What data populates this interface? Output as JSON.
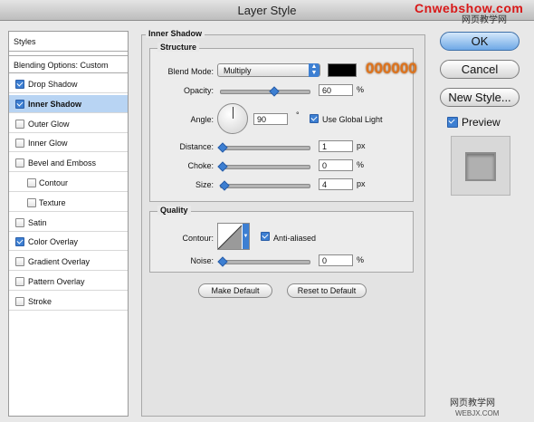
{
  "window": {
    "title": "Layer Style",
    "watermark_top": "Cnwebshow.com",
    "watermark_sub": "网页教学网",
    "watermark_bottom": "网页教学网",
    "watermark_bottom_url": "WEBJX.COM"
  },
  "sidebar": {
    "styles_header": "Styles",
    "blending_options": "Blending Options: Custom",
    "items": [
      {
        "label": "Drop Shadow",
        "checked": true,
        "selected": false,
        "indent": false
      },
      {
        "label": "Inner Shadow",
        "checked": true,
        "selected": true,
        "indent": false
      },
      {
        "label": "Outer Glow",
        "checked": false,
        "selected": false,
        "indent": false
      },
      {
        "label": "Inner Glow",
        "checked": false,
        "selected": false,
        "indent": false
      },
      {
        "label": "Bevel and Emboss",
        "checked": false,
        "selected": false,
        "indent": false
      },
      {
        "label": "Contour",
        "checked": false,
        "selected": false,
        "indent": true
      },
      {
        "label": "Texture",
        "checked": false,
        "selected": false,
        "indent": true
      },
      {
        "label": "Satin",
        "checked": false,
        "selected": false,
        "indent": false
      },
      {
        "label": "Color Overlay",
        "checked": true,
        "selected": false,
        "indent": false
      },
      {
        "label": "Gradient Overlay",
        "checked": false,
        "selected": false,
        "indent": false
      },
      {
        "label": "Pattern Overlay",
        "checked": false,
        "selected": false,
        "indent": false
      },
      {
        "label": "Stroke",
        "checked": false,
        "selected": false,
        "indent": false
      }
    ]
  },
  "panel": {
    "title": "Inner Shadow",
    "structure": {
      "title": "Structure",
      "blend_mode_label": "Blend Mode:",
      "blend_mode_value": "Multiply",
      "color_swatch": "#000000",
      "color_annotation": "000000",
      "opacity_label": "Opacity:",
      "opacity_value": "60",
      "opacity_unit": "%",
      "opacity_level": 0.6,
      "angle_label": "Angle:",
      "angle_value": "90",
      "angle_unit": "°",
      "use_global_light_label": "Use Global Light",
      "use_global_light_checked": true,
      "distance_label": "Distance:",
      "distance_value": "1",
      "distance_unit": "px",
      "choke_label": "Choke:",
      "choke_value": "0",
      "choke_unit": "%",
      "size_label": "Size:",
      "size_value": "4",
      "size_unit": "px"
    },
    "quality": {
      "title": "Quality",
      "contour_label": "Contour:",
      "anti_aliased_label": "Anti-aliased",
      "anti_aliased_checked": true,
      "noise_label": "Noise:",
      "noise_value": "0",
      "noise_unit": "%"
    },
    "make_default": "Make Default",
    "reset_to_default": "Reset to Default"
  },
  "actions": {
    "ok": "OK",
    "cancel": "Cancel",
    "new_style": "New Style...",
    "preview_label": "Preview",
    "preview_checked": true
  },
  "colors": {
    "accent": "#3d7fd2",
    "annotation": "#e0731b",
    "selection": "#b8d4f3"
  }
}
